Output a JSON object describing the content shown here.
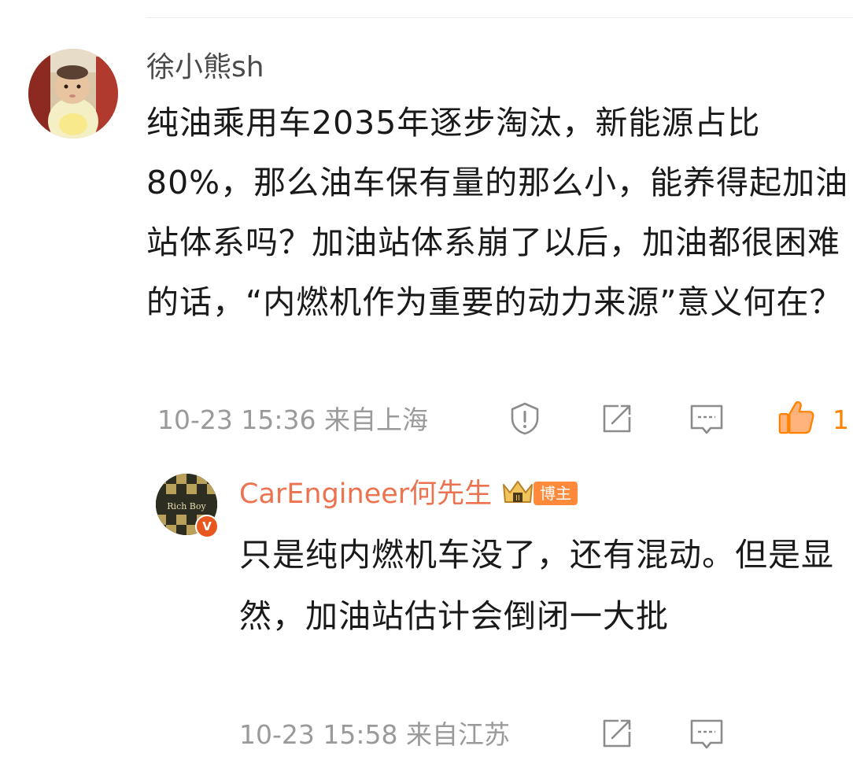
{
  "main_comment": {
    "username": "徐小熊sh",
    "text": "纯油乘用车2035年逐步淘汰，新能源占比80%，那么油车保有量的那么小，能养得起加油站体系吗？加油站体系崩了以后，加油都很困难的话，“内燃机作为重要的动力来源”意义何在？",
    "timestamp": "10-23 15:36",
    "location": "来自上海",
    "like_count": "1",
    "icons": [
      "report-icon",
      "repost-icon",
      "comment-icon",
      "like-icon"
    ]
  },
  "reply": {
    "username": "CarEngineer何先生",
    "avatar_text": "Rich Boy",
    "verified_mark": "V",
    "author_badge": "博主",
    "text": "只是纯内燃机车没了，还有混动。但是显然，加油站估计会倒闭一大批",
    "timestamp": "10-23 15:58",
    "location": "来自江苏",
    "icons": [
      "repost-icon",
      "comment-icon"
    ]
  },
  "colors": {
    "username_main": "#4a4a4a",
    "username_reply": "#eb7350",
    "meta": "#9a9a9a",
    "like_accent": "#ff8200",
    "badge": "#ff8a3c",
    "verified": "#e8571f"
  }
}
